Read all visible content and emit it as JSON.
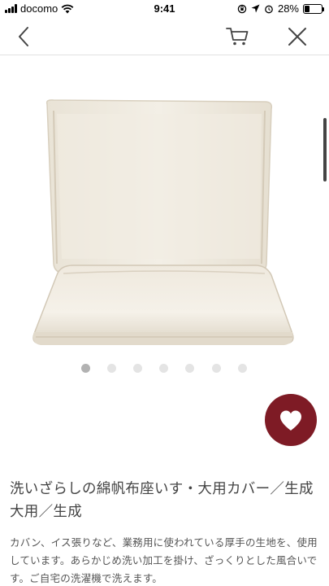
{
  "status_bar": {
    "carrier": "docomo",
    "time": "9:41",
    "battery": "28%",
    "battery_level": 0.28
  },
  "nav": {
    "back_icon": "chevron-left-icon",
    "cart_icon": "cart-icon",
    "close_icon": "close-icon"
  },
  "gallery": {
    "image_count": 7,
    "active_index": 0
  },
  "favorite": {
    "icon": "heart-icon",
    "color": "#7e1b25"
  },
  "product": {
    "title": "洗いざらしの綿帆布座いす・大用カバー／生成 大用／生成",
    "description": "カバン、イス張りなど、業務用に使われている厚手の生地を、使用しています。あらかじめ洗い加工を掛け、ざっくりとした風合いです。ご自宅の洗濯機で洗えます。"
  }
}
